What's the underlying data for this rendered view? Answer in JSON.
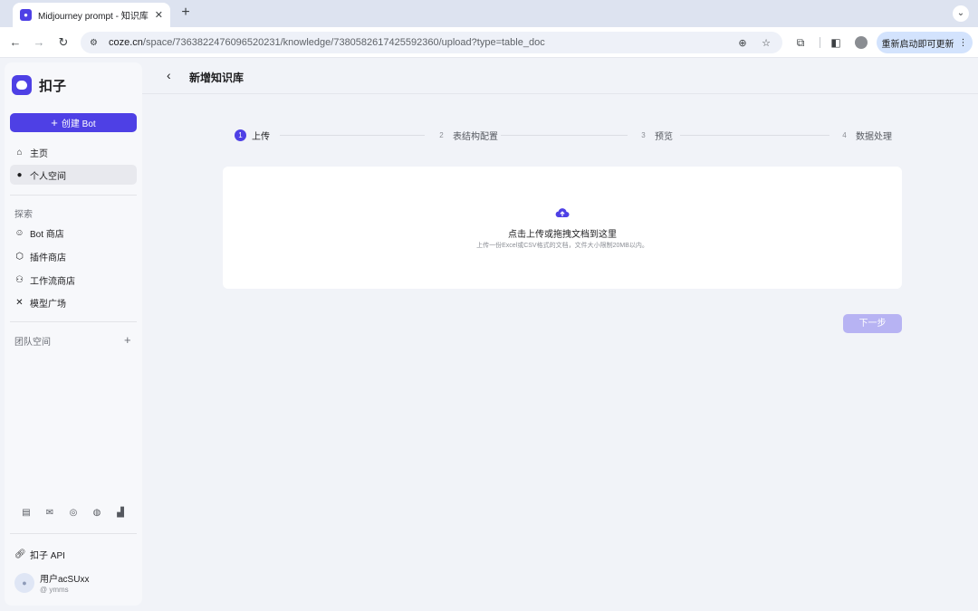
{
  "browser": {
    "tab_title": "Midjourney prompt - 知识库 -",
    "tab_close": "✕",
    "new_tab": "+",
    "tab_menu": "⌄",
    "url_host": "coze.cn",
    "url_path": "/space/7363822476096520231/knowledge/7380582617425592360/upload?type=table_doc",
    "update_label": "重新启动即可更新",
    "update_menu": "⋮"
  },
  "sidebar": {
    "brand": "扣子",
    "create_label": "创建 Bot",
    "create_plus": "+",
    "nav": {
      "home": "主页",
      "personal": "个人空间"
    },
    "explore_label": "探索",
    "explore": {
      "bot_store": "Bot 商店",
      "plugin_store": "插件商店",
      "workflow_store": "工作流商店",
      "model_plaza": "模型广场"
    },
    "team_label": "团队空间",
    "team_add": "+",
    "api_label": "扣子 API",
    "user": {
      "name": "用户acSUxx",
      "handle": "@ ymms"
    }
  },
  "main": {
    "back": "‹",
    "title": "新增知识库",
    "steps": [
      {
        "num": "1",
        "label": "上传"
      },
      {
        "num": "2",
        "label": "表结构配置"
      },
      {
        "num": "3",
        "label": "预览"
      },
      {
        "num": "4",
        "label": "数据处理"
      }
    ],
    "active_step": 1,
    "upload": {
      "title": "点击上传或拖拽文档到这里",
      "hint": "上传一份Excel或CSV格式的文档，文件大小限制20MB以内。"
    },
    "next_label": "下一步"
  },
  "colors": {
    "accent": "#4e40e5",
    "accent_disabled": "#b7b3f3",
    "page_bg": "#f1f3f8"
  },
  "icons": [
    "search-icon",
    "star-icon",
    "extension-icon",
    "sidebar-icon",
    "home-icon",
    "user-icon",
    "bot-icon",
    "plugin-icon",
    "workflow-icon",
    "model-icon",
    "upload-cloud-icon",
    "link-icon"
  ]
}
